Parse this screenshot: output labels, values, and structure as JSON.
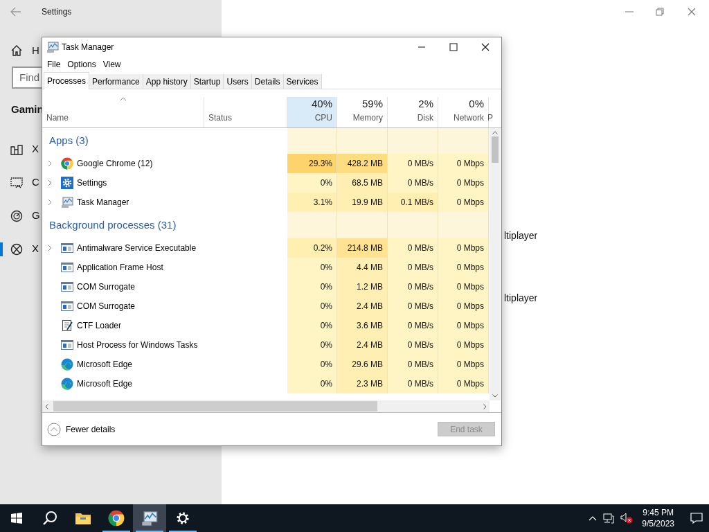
{
  "settings": {
    "title": "Settings",
    "search": {
      "placeholder": "Find"
    },
    "heading": "Gamin",
    "nav": [
      {
        "kind": "home",
        "label": "H",
        "selected": false
      },
      {
        "kind": "bar",
        "label": "X",
        "selected": false
      },
      {
        "kind": "capture",
        "label": "C",
        "selected": false
      },
      {
        "kind": "gauge",
        "label": "G",
        "selected": false
      },
      {
        "kind": "xbox",
        "label": "X",
        "selected": true
      }
    ],
    "content": [
      "ltiplayer",
      "ltiplayer"
    ]
  },
  "task_manager": {
    "title": "Task Manager",
    "menu": [
      "File",
      "Options",
      "View"
    ],
    "tabs": [
      {
        "label": "Processes",
        "selected": true
      },
      {
        "label": "Performance",
        "selected": false
      },
      {
        "label": "App history",
        "selected": false
      },
      {
        "label": "Startup",
        "selected": false
      },
      {
        "label": "Users",
        "selected": false
      },
      {
        "label": "Details",
        "selected": false
      },
      {
        "label": "Services",
        "selected": false
      }
    ],
    "columns": [
      {
        "label": "Name",
        "sorted": true,
        "hovered": false
      },
      {
        "label": "Status",
        "sorted": false,
        "hovered": false
      },
      {
        "value": "40%",
        "label": "CPU",
        "sorted": false,
        "hovered": true
      },
      {
        "value": "59%",
        "label": "Memory",
        "sorted": false,
        "hovered": false
      },
      {
        "value": "2%",
        "label": "Disk",
        "sorted": false,
        "hovered": false
      },
      {
        "value": "0%",
        "label": "Network",
        "sorted": false,
        "hovered": false
      },
      {
        "label": "P",
        "sorted": false,
        "hovered": false
      }
    ],
    "groups": [
      {
        "title": "Apps (3)",
        "rows": [
          {
            "kind": "chrome",
            "name": "Google Chrome (12)",
            "expandable": true,
            "cells": [
              {
                "text": "29.3%",
                "color": "#fdd46b"
              },
              {
                "text": "428.2 MB",
                "color": "#fedc80"
              },
              {
                "text": "0 MB/s",
                "color": "#fff4c4"
              },
              {
                "text": "0 Mbps",
                "color": "#fff4c4"
              }
            ]
          },
          {
            "kind": "gear",
            "name": "Settings",
            "expandable": true,
            "cells": [
              {
                "text": "0%",
                "color": "#fff4c4"
              },
              {
                "text": "68.5 MB",
                "color": "#ffefb2"
              },
              {
                "text": "0 MB/s",
                "color": "#fff4c4"
              },
              {
                "text": "0 Mbps",
                "color": "#fff4c4"
              }
            ]
          },
          {
            "kind": "monitor",
            "name": "Task Manager",
            "expandable": true,
            "cells": [
              {
                "text": "3.1%",
                "color": "#ffefb0"
              },
              {
                "text": "19.9 MB",
                "color": "#ffefb0"
              },
              {
                "text": "0.1 MB/s",
                "color": "#ffefb0"
              },
              {
                "text": "0 Mbps",
                "color": "#fff4c4"
              }
            ]
          }
        ]
      },
      {
        "title": "Background processes (31)",
        "rows": [
          {
            "kind": "window",
            "name": "Antimalware Service Executable",
            "expandable": true,
            "cells": [
              {
                "text": "0.2%",
                "color": "#ffefb0"
              },
              {
                "text": "214.8 MB",
                "color": "#ffe292"
              },
              {
                "text": "0 MB/s",
                "color": "#fff4c4"
              },
              {
                "text": "0 Mbps",
                "color": "#fff4c4"
              }
            ]
          },
          {
            "kind": "window",
            "name": "Application Frame Host",
            "expandable": false,
            "cells": [
              {
                "text": "0%",
                "color": "#fff4c4"
              },
              {
                "text": "4.4 MB",
                "color": "#ffefb2"
              },
              {
                "text": "0 MB/s",
                "color": "#fff4c4"
              },
              {
                "text": "0 Mbps",
                "color": "#fff4c4"
              }
            ]
          },
          {
            "kind": "window",
            "name": "COM Surrogate",
            "expandable": false,
            "cells": [
              {
                "text": "0%",
                "color": "#fff4c4"
              },
              {
                "text": "1.2 MB",
                "color": "#ffefb2"
              },
              {
                "text": "0 MB/s",
                "color": "#fff4c4"
              },
              {
                "text": "0 Mbps",
                "color": "#fff4c4"
              }
            ]
          },
          {
            "kind": "window",
            "name": "COM Surrogate",
            "expandable": false,
            "cells": [
              {
                "text": "0%",
                "color": "#fff4c4"
              },
              {
                "text": "2.4 MB",
                "color": "#ffefb2"
              },
              {
                "text": "0 MB/s",
                "color": "#fff4c4"
              },
              {
                "text": "0 Mbps",
                "color": "#fff4c4"
              }
            ]
          },
          {
            "kind": "notepad",
            "name": "CTF Loader",
            "expandable": false,
            "cells": [
              {
                "text": "0%",
                "color": "#fff4c4"
              },
              {
                "text": "3.6 MB",
                "color": "#ffefb2"
              },
              {
                "text": "0 MB/s",
                "color": "#fff4c4"
              },
              {
                "text": "0 Mbps",
                "color": "#fff4c4"
              }
            ]
          },
          {
            "kind": "window",
            "name": "Host Process for Windows Tasks",
            "expandable": false,
            "cells": [
              {
                "text": "0%",
                "color": "#fff4c4"
              },
              {
                "text": "2.4 MB",
                "color": "#ffefb2"
              },
              {
                "text": "0 MB/s",
                "color": "#fff4c4"
              },
              {
                "text": "0 Mbps",
                "color": "#fff4c4"
              }
            ]
          },
          {
            "kind": "edge",
            "name": "Microsoft Edge",
            "expandable": false,
            "cells": [
              {
                "text": "0%",
                "color": "#fff4c4"
              },
              {
                "text": "29.6 MB",
                "color": "#ffefb2"
              },
              {
                "text": "0 MB/s",
                "color": "#fff4c4"
              },
              {
                "text": "0 Mbps",
                "color": "#fff4c4"
              }
            ]
          },
          {
            "kind": "edge",
            "name": "Microsoft Edge",
            "expandable": false,
            "cells": [
              {
                "text": "0%",
                "color": "#fff4c4"
              },
              {
                "text": "2.3 MB",
                "color": "#ffefb2"
              },
              {
                "text": "0 MB/s",
                "color": "#fff4c4"
              },
              {
                "text": "0 Mbps",
                "color": "#fff4c4"
              }
            ]
          }
        ]
      }
    ],
    "footer": {
      "fewer_details": "Fewer details",
      "end_task": {
        "label": "End task",
        "disabled": true
      }
    }
  },
  "taskbar": {
    "apps": [
      {
        "kind": "start",
        "running": false,
        "selected": false
      },
      {
        "kind": "search",
        "running": false,
        "selected": false
      },
      {
        "kind": "folder",
        "running": false,
        "selected": false
      },
      {
        "kind": "chrome",
        "running": true,
        "selected": false
      },
      {
        "kind": "taskmanager",
        "running": true,
        "selected": true
      },
      {
        "kind": "gear",
        "running": true,
        "selected": false
      }
    ],
    "time": "9:45 PM",
    "date": "9/5/2023"
  }
}
